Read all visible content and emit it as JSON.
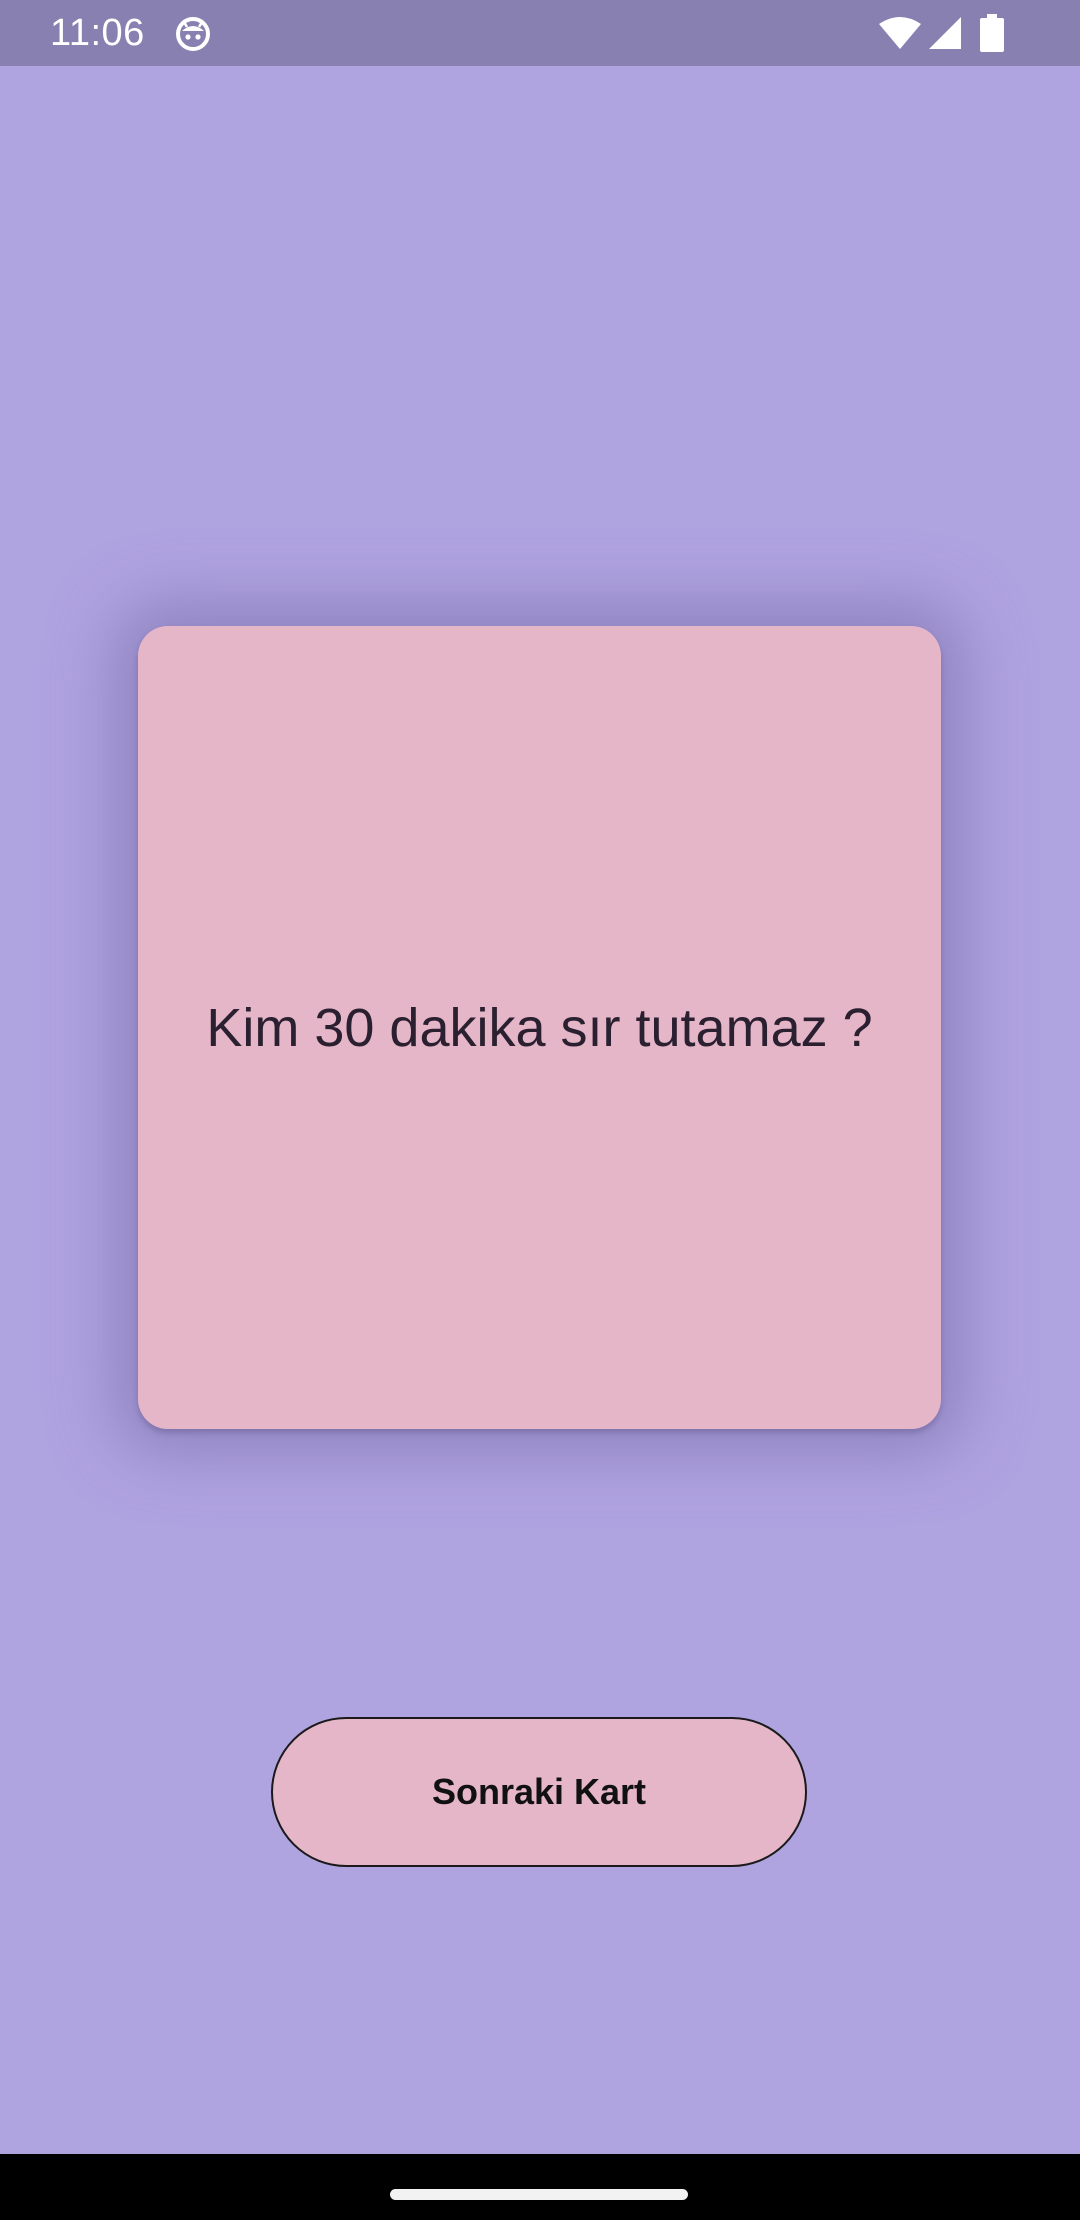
{
  "status_bar": {
    "time": "11:06",
    "icons": [
      "android-face-icon",
      "wifi-icon",
      "signal-icon",
      "battery-icon"
    ]
  },
  "card": {
    "question": "Kim 30 dakika sır tutamaz ?"
  },
  "next_button": {
    "label": "Sonraki Kart"
  },
  "colors": {
    "background": "#afa3e0",
    "status_bar": "#8880b0",
    "card": "#e5b5c8",
    "button": "#e5b5c8",
    "nav_bar": "#000000"
  }
}
